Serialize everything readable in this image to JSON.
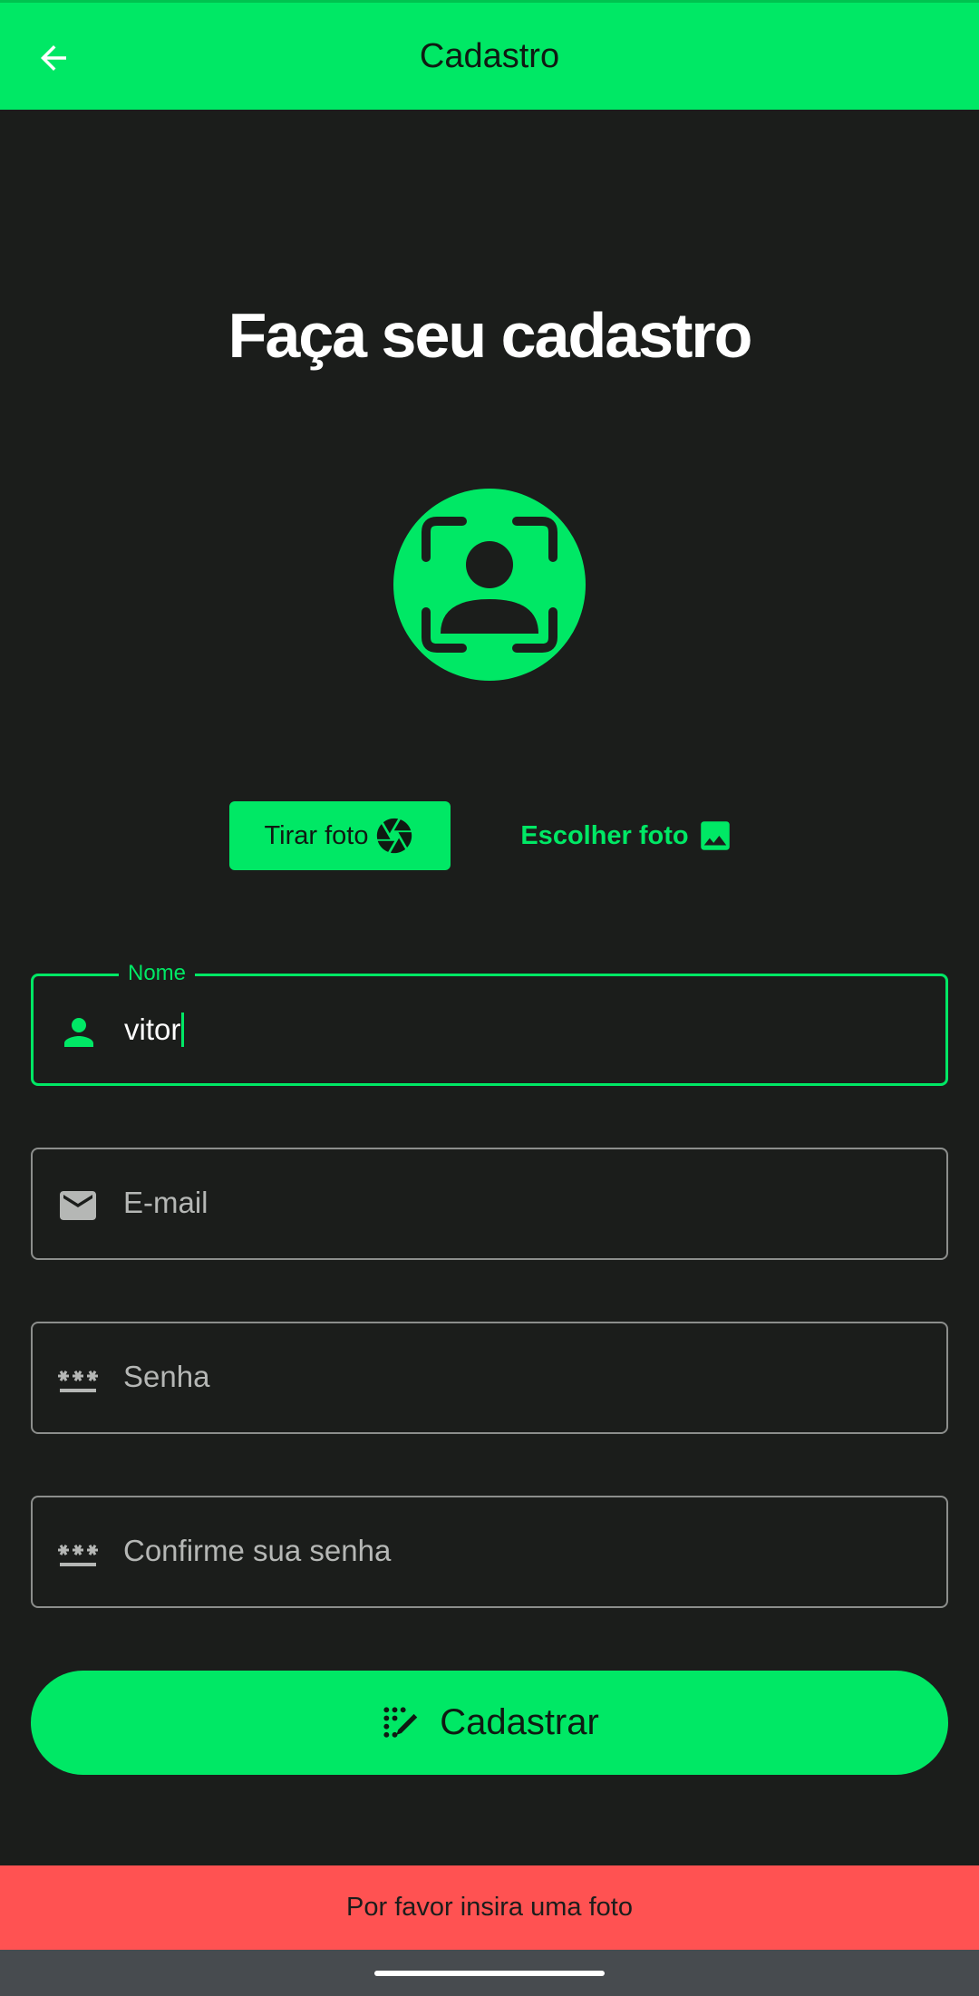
{
  "appbar": {
    "title": "Cadastro",
    "back_icon": "arrow-back-icon"
  },
  "headline": "Faça seu cadastro",
  "avatar": {
    "icon": "face-scan-icon"
  },
  "photo_buttons": {
    "take_label": "Tirar foto",
    "take_icon": "camera-shutter-icon",
    "choose_label": "Escolher foto",
    "choose_icon": "image-icon"
  },
  "form": {
    "name": {
      "label": "Nome",
      "value": "vitor",
      "icon": "person-icon"
    },
    "email": {
      "placeholder": "E-mail",
      "icon": "mail-icon"
    },
    "password": {
      "placeholder": "Senha",
      "icon": "password-icon"
    },
    "confirm": {
      "placeholder": "Confirme sua senha",
      "icon": "password-icon"
    }
  },
  "submit": {
    "label": "Cadastrar",
    "icon": "draw-sparkle-icon"
  },
  "snackbar": {
    "message": "Por favor insira uma foto"
  },
  "colors": {
    "accent": "#00e865",
    "background": "#1b1d1b",
    "error": "#ff5252"
  }
}
